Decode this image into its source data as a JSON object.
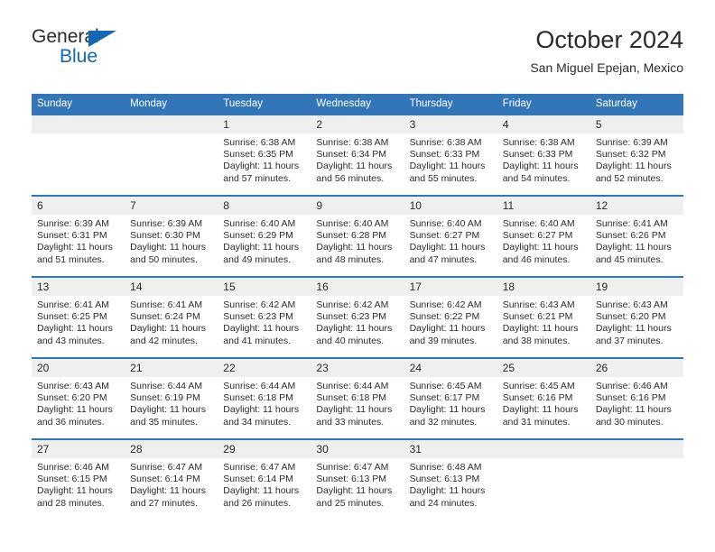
{
  "brand": {
    "line1": "General",
    "line2": "Blue",
    "triangle_color": "#1268b3",
    "text_color": "#2b2b2b"
  },
  "header": {
    "title": "October 2024",
    "subtitle": "San Miguel Epejan, Mexico"
  },
  "theme": {
    "header_blue": "#3275b8",
    "daynum_band": "#efefef",
    "text": "#2b2b2b"
  },
  "weekdays": [
    "Sunday",
    "Monday",
    "Tuesday",
    "Wednesday",
    "Thursday",
    "Friday",
    "Saturday"
  ],
  "weeks": [
    {
      "days": [
        {
          "num": "",
          "sunrise": "",
          "sunset": "",
          "daylight1": "",
          "daylight2": ""
        },
        {
          "num": "",
          "sunrise": "",
          "sunset": "",
          "daylight1": "",
          "daylight2": ""
        },
        {
          "num": "1",
          "sunrise": "Sunrise: 6:38 AM",
          "sunset": "Sunset: 6:35 PM",
          "daylight1": "Daylight: 11 hours",
          "daylight2": "and 57 minutes."
        },
        {
          "num": "2",
          "sunrise": "Sunrise: 6:38 AM",
          "sunset": "Sunset: 6:34 PM",
          "daylight1": "Daylight: 11 hours",
          "daylight2": "and 56 minutes."
        },
        {
          "num": "3",
          "sunrise": "Sunrise: 6:38 AM",
          "sunset": "Sunset: 6:33 PM",
          "daylight1": "Daylight: 11 hours",
          "daylight2": "and 55 minutes."
        },
        {
          "num": "4",
          "sunrise": "Sunrise: 6:38 AM",
          "sunset": "Sunset: 6:33 PM",
          "daylight1": "Daylight: 11 hours",
          "daylight2": "and 54 minutes."
        },
        {
          "num": "5",
          "sunrise": "Sunrise: 6:39 AM",
          "sunset": "Sunset: 6:32 PM",
          "daylight1": "Daylight: 11 hours",
          "daylight2": "and 52 minutes."
        }
      ]
    },
    {
      "days": [
        {
          "num": "6",
          "sunrise": "Sunrise: 6:39 AM",
          "sunset": "Sunset: 6:31 PM",
          "daylight1": "Daylight: 11 hours",
          "daylight2": "and 51 minutes."
        },
        {
          "num": "7",
          "sunrise": "Sunrise: 6:39 AM",
          "sunset": "Sunset: 6:30 PM",
          "daylight1": "Daylight: 11 hours",
          "daylight2": "and 50 minutes."
        },
        {
          "num": "8",
          "sunrise": "Sunrise: 6:40 AM",
          "sunset": "Sunset: 6:29 PM",
          "daylight1": "Daylight: 11 hours",
          "daylight2": "and 49 minutes."
        },
        {
          "num": "9",
          "sunrise": "Sunrise: 6:40 AM",
          "sunset": "Sunset: 6:28 PM",
          "daylight1": "Daylight: 11 hours",
          "daylight2": "and 48 minutes."
        },
        {
          "num": "10",
          "sunrise": "Sunrise: 6:40 AM",
          "sunset": "Sunset: 6:27 PM",
          "daylight1": "Daylight: 11 hours",
          "daylight2": "and 47 minutes."
        },
        {
          "num": "11",
          "sunrise": "Sunrise: 6:40 AM",
          "sunset": "Sunset: 6:27 PM",
          "daylight1": "Daylight: 11 hours",
          "daylight2": "and 46 minutes."
        },
        {
          "num": "12",
          "sunrise": "Sunrise: 6:41 AM",
          "sunset": "Sunset: 6:26 PM",
          "daylight1": "Daylight: 11 hours",
          "daylight2": "and 45 minutes."
        }
      ]
    },
    {
      "days": [
        {
          "num": "13",
          "sunrise": "Sunrise: 6:41 AM",
          "sunset": "Sunset: 6:25 PM",
          "daylight1": "Daylight: 11 hours",
          "daylight2": "and 43 minutes."
        },
        {
          "num": "14",
          "sunrise": "Sunrise: 6:41 AM",
          "sunset": "Sunset: 6:24 PM",
          "daylight1": "Daylight: 11 hours",
          "daylight2": "and 42 minutes."
        },
        {
          "num": "15",
          "sunrise": "Sunrise: 6:42 AM",
          "sunset": "Sunset: 6:23 PM",
          "daylight1": "Daylight: 11 hours",
          "daylight2": "and 41 minutes."
        },
        {
          "num": "16",
          "sunrise": "Sunrise: 6:42 AM",
          "sunset": "Sunset: 6:23 PM",
          "daylight1": "Daylight: 11 hours",
          "daylight2": "and 40 minutes."
        },
        {
          "num": "17",
          "sunrise": "Sunrise: 6:42 AM",
          "sunset": "Sunset: 6:22 PM",
          "daylight1": "Daylight: 11 hours",
          "daylight2": "and 39 minutes."
        },
        {
          "num": "18",
          "sunrise": "Sunrise: 6:43 AM",
          "sunset": "Sunset: 6:21 PM",
          "daylight1": "Daylight: 11 hours",
          "daylight2": "and 38 minutes."
        },
        {
          "num": "19",
          "sunrise": "Sunrise: 6:43 AM",
          "sunset": "Sunset: 6:20 PM",
          "daylight1": "Daylight: 11 hours",
          "daylight2": "and 37 minutes."
        }
      ]
    },
    {
      "days": [
        {
          "num": "20",
          "sunrise": "Sunrise: 6:43 AM",
          "sunset": "Sunset: 6:20 PM",
          "daylight1": "Daylight: 11 hours",
          "daylight2": "and 36 minutes."
        },
        {
          "num": "21",
          "sunrise": "Sunrise: 6:44 AM",
          "sunset": "Sunset: 6:19 PM",
          "daylight1": "Daylight: 11 hours",
          "daylight2": "and 35 minutes."
        },
        {
          "num": "22",
          "sunrise": "Sunrise: 6:44 AM",
          "sunset": "Sunset: 6:18 PM",
          "daylight1": "Daylight: 11 hours",
          "daylight2": "and 34 minutes."
        },
        {
          "num": "23",
          "sunrise": "Sunrise: 6:44 AM",
          "sunset": "Sunset: 6:18 PM",
          "daylight1": "Daylight: 11 hours",
          "daylight2": "and 33 minutes."
        },
        {
          "num": "24",
          "sunrise": "Sunrise: 6:45 AM",
          "sunset": "Sunset: 6:17 PM",
          "daylight1": "Daylight: 11 hours",
          "daylight2": "and 32 minutes."
        },
        {
          "num": "25",
          "sunrise": "Sunrise: 6:45 AM",
          "sunset": "Sunset: 6:16 PM",
          "daylight1": "Daylight: 11 hours",
          "daylight2": "and 31 minutes."
        },
        {
          "num": "26",
          "sunrise": "Sunrise: 6:46 AM",
          "sunset": "Sunset: 6:16 PM",
          "daylight1": "Daylight: 11 hours",
          "daylight2": "and 30 minutes."
        }
      ]
    },
    {
      "days": [
        {
          "num": "27",
          "sunrise": "Sunrise: 6:46 AM",
          "sunset": "Sunset: 6:15 PM",
          "daylight1": "Daylight: 11 hours",
          "daylight2": "and 28 minutes."
        },
        {
          "num": "28",
          "sunrise": "Sunrise: 6:47 AM",
          "sunset": "Sunset: 6:14 PM",
          "daylight1": "Daylight: 11 hours",
          "daylight2": "and 27 minutes."
        },
        {
          "num": "29",
          "sunrise": "Sunrise: 6:47 AM",
          "sunset": "Sunset: 6:14 PM",
          "daylight1": "Daylight: 11 hours",
          "daylight2": "and 26 minutes."
        },
        {
          "num": "30",
          "sunrise": "Sunrise: 6:47 AM",
          "sunset": "Sunset: 6:13 PM",
          "daylight1": "Daylight: 11 hours",
          "daylight2": "and 25 minutes."
        },
        {
          "num": "31",
          "sunrise": "Sunrise: 6:48 AM",
          "sunset": "Sunset: 6:13 PM",
          "daylight1": "Daylight: 11 hours",
          "daylight2": "and 24 minutes."
        },
        {
          "num": "",
          "sunrise": "",
          "sunset": "",
          "daylight1": "",
          "daylight2": ""
        },
        {
          "num": "",
          "sunrise": "",
          "sunset": "",
          "daylight1": "",
          "daylight2": ""
        }
      ]
    }
  ]
}
